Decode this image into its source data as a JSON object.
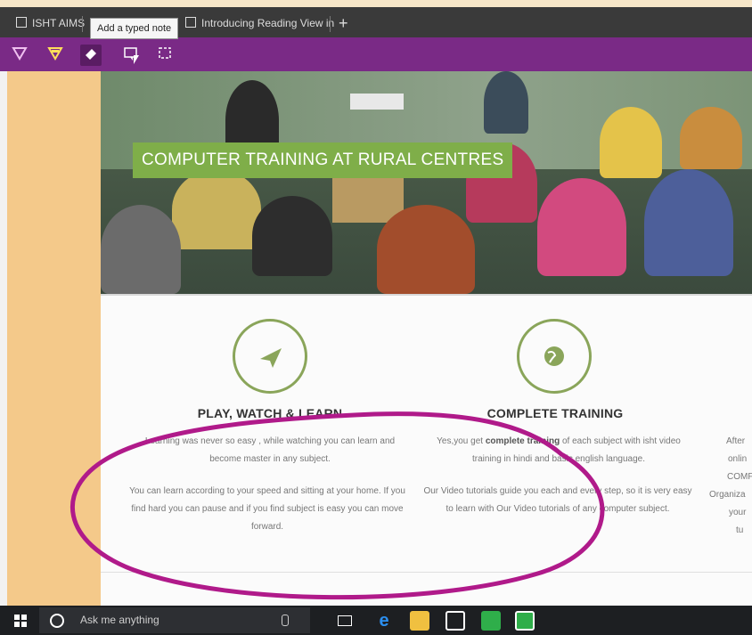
{
  "browser": {
    "tabs": [
      {
        "label": "ISHT AIMS"
      },
      {
        "label": "Introducing Reading View in"
      }
    ],
    "new_tab_label": "+",
    "tooltip": "Add a typed note"
  },
  "toolbar": {
    "tools": [
      "pen",
      "highlighter",
      "eraser",
      "typed-note",
      "clip"
    ],
    "colors": {
      "bar": "#7a2a86",
      "pen": "#f0c0f0",
      "highlighter": "#ffdf5a"
    }
  },
  "hero": {
    "banner_text": "COMPUTER TRAINING AT RURAL CENTRES"
  },
  "features": [
    {
      "title": "PLAY, WATCH & LEARN",
      "p1": "Learning was never so easy , while watching you can learn and become master in any subject.",
      "p2": "You can learn according to your speed and sitting at your home. If you find hard you can pause and if you find subject is easy you can move forward.",
      "icon": "paper-plane-icon"
    },
    {
      "title": "COMPLETE TRAINING",
      "p1_pre": "Yes,you get ",
      "p1_bold": "complete training",
      "p1_post": " of each subject with isht video training in hindi and basic english language.",
      "p2": "Our Video tutorials guide you each and every step, so it is very easy to learn with Our Video tutorials of any computer subject.",
      "icon": "globe-icon"
    }
  ],
  "cut_column": [
    "After",
    "onlin",
    "COMF",
    "Organiza",
    "your",
    "tu"
  ],
  "taskbar": {
    "search_placeholder": "Ask me anything"
  }
}
